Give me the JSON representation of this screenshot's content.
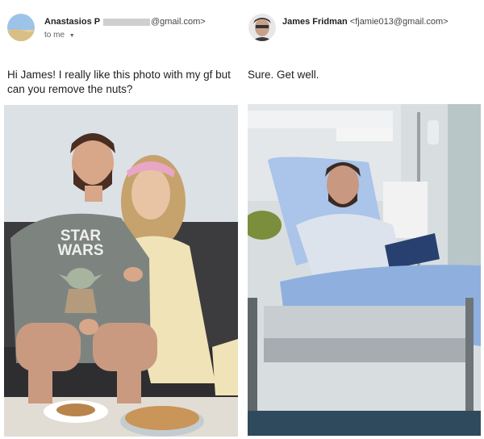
{
  "left_email": {
    "sender_name": "Anastasios P",
    "sender_email": "@gmail.com>",
    "recipient": "to me",
    "message": "Hi James! I really like this photo with my gf but can you remove the nuts?"
  },
  "right_email": {
    "sender_name": "James Fridman",
    "sender_email": "<fjamie013@gmail.com>",
    "message": "Sure. Get well."
  },
  "sweater_text": [
    "STAR",
    "WARS"
  ],
  "colors": {
    "sweater": "#7d8480",
    "blanket": "#8fb0de",
    "wall": "#d8dde2"
  }
}
